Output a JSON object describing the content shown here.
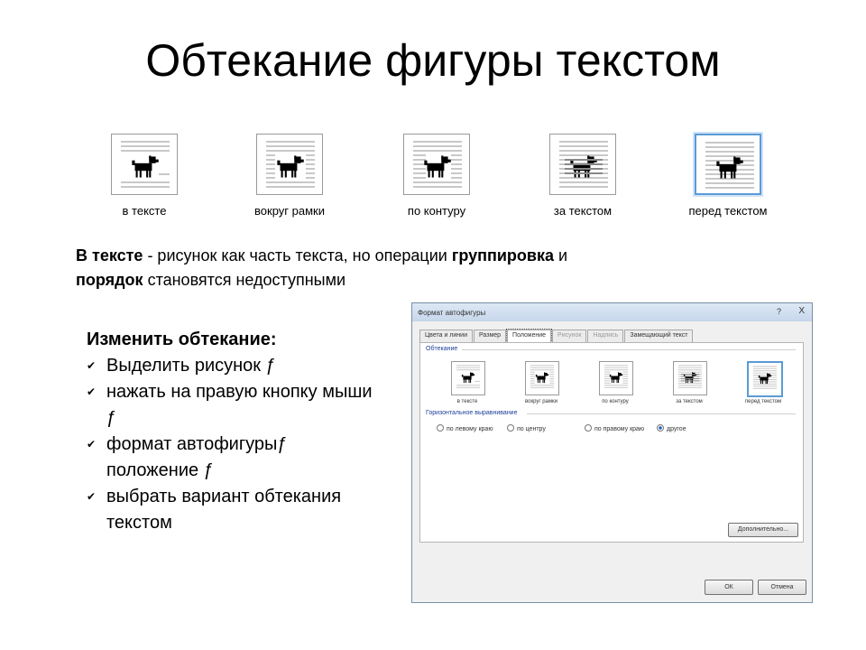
{
  "title": "Обтекание фигуры текстом",
  "wrap_options": [
    {
      "label": "в тексте",
      "selected": false
    },
    {
      "label": "вокруг рамки",
      "selected": false
    },
    {
      "label": "по контуру",
      "selected": false
    },
    {
      "label": "за текстом",
      "selected": false
    },
    {
      "label": "перед текстом",
      "selected": true
    }
  ],
  "description": {
    "term1": "В тексте",
    "text1": " - рисунок как часть текста, но операции ",
    "term2": "группировка",
    "text2": " и ",
    "term3": "порядок",
    "text3": " становятся недоступными"
  },
  "steps": {
    "header": "Изменить обтекание:",
    "items": [
      "Выделить рисунок ƒ",
      "нажать на правую кнопку мыши ƒ",
      "формат автофигурыƒ положение ƒ",
      "выбрать вариант обтекания текстом"
    ]
  },
  "dialog": {
    "title": "Формат автофигуры",
    "help": "?",
    "close": "X",
    "tabs": [
      {
        "label": "Цвета и линии",
        "state": "normal"
      },
      {
        "label": "Размер",
        "state": "normal"
      },
      {
        "label": "Положение",
        "state": "active"
      },
      {
        "label": "Рисунок",
        "state": "disabled"
      },
      {
        "label": "Надпись",
        "state": "disabled"
      },
      {
        "label": "Замещающий текст",
        "state": "normal"
      }
    ],
    "wrap_group_label": "Обтекание",
    "wrap_options": [
      "в тексте",
      "вокруг рамки",
      "по контуру",
      "за текстом",
      "перед текстом"
    ],
    "align_group_label": "Горизонтальное выравнивание",
    "align_options": [
      {
        "label": "по левому краю",
        "checked": false
      },
      {
        "label": "по центру",
        "checked": false
      },
      {
        "label": "по правому краю",
        "checked": false
      },
      {
        "label": "другое",
        "checked": true
      }
    ],
    "advanced_button": "Дополнительно...",
    "ok_button": "ОК",
    "cancel_button": "Отмена"
  },
  "colors": {
    "selected_border": "#5b9bd5",
    "line_gray": "#b5b5b5",
    "text_lines": "#c8c8c8"
  }
}
